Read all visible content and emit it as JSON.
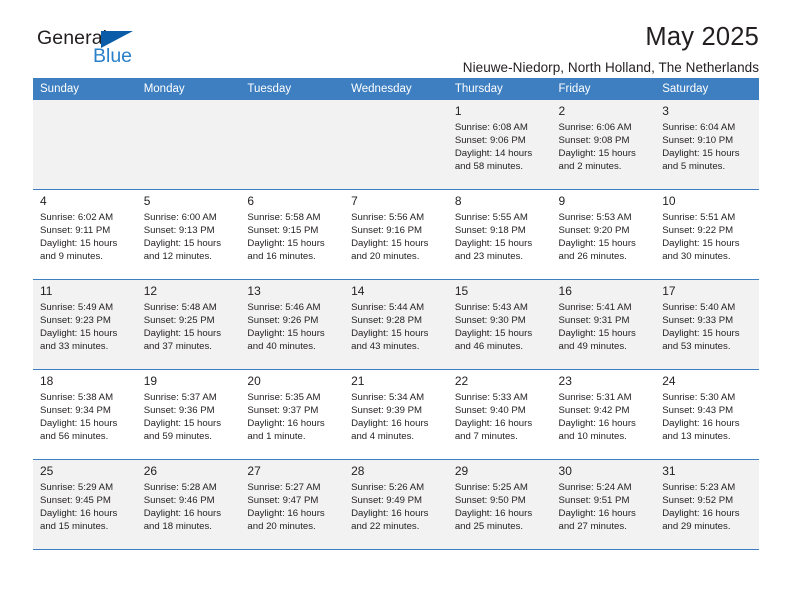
{
  "brand": {
    "name_top": "General",
    "name_bottom": "Blue",
    "triangle_color": "#0a5ca8",
    "blue_text_color": "#2a7fc9"
  },
  "header": {
    "title": "May 2025",
    "subtitle": "Nieuwe-Niedorp, North Holland, The Netherlands",
    "header_bg": "#3d7fc1",
    "shaded_cell_bg": "#f2f2f2"
  },
  "weekdays": [
    "Sunday",
    "Monday",
    "Tuesday",
    "Wednesday",
    "Thursday",
    "Friday",
    "Saturday"
  ],
  "weeks": [
    [
      {
        "day": "",
        "lines": [],
        "shaded": true,
        "empty": true
      },
      {
        "day": "",
        "lines": [],
        "shaded": true,
        "empty": true
      },
      {
        "day": "",
        "lines": [],
        "shaded": true,
        "empty": true
      },
      {
        "day": "",
        "lines": [],
        "shaded": true,
        "empty": true
      },
      {
        "day": "1",
        "lines": [
          "Sunrise: 6:08 AM",
          "Sunset: 9:06 PM",
          "Daylight: 14 hours",
          "and 58 minutes."
        ],
        "shaded": true,
        "empty": false
      },
      {
        "day": "2",
        "lines": [
          "Sunrise: 6:06 AM",
          "Sunset: 9:08 PM",
          "Daylight: 15 hours",
          "and 2 minutes."
        ],
        "shaded": true,
        "empty": false
      },
      {
        "day": "3",
        "lines": [
          "Sunrise: 6:04 AM",
          "Sunset: 9:10 PM",
          "Daylight: 15 hours",
          "and 5 minutes."
        ],
        "shaded": true,
        "empty": false
      }
    ],
    [
      {
        "day": "4",
        "lines": [
          "Sunrise: 6:02 AM",
          "Sunset: 9:11 PM",
          "Daylight: 15 hours",
          "and 9 minutes."
        ],
        "shaded": false,
        "empty": false
      },
      {
        "day": "5",
        "lines": [
          "Sunrise: 6:00 AM",
          "Sunset: 9:13 PM",
          "Daylight: 15 hours",
          "and 12 minutes."
        ],
        "shaded": false,
        "empty": false
      },
      {
        "day": "6",
        "lines": [
          "Sunrise: 5:58 AM",
          "Sunset: 9:15 PM",
          "Daylight: 15 hours",
          "and 16 minutes."
        ],
        "shaded": false,
        "empty": false
      },
      {
        "day": "7",
        "lines": [
          "Sunrise: 5:56 AM",
          "Sunset: 9:16 PM",
          "Daylight: 15 hours",
          "and 20 minutes."
        ],
        "shaded": false,
        "empty": false
      },
      {
        "day": "8",
        "lines": [
          "Sunrise: 5:55 AM",
          "Sunset: 9:18 PM",
          "Daylight: 15 hours",
          "and 23 minutes."
        ],
        "shaded": false,
        "empty": false
      },
      {
        "day": "9",
        "lines": [
          "Sunrise: 5:53 AM",
          "Sunset: 9:20 PM",
          "Daylight: 15 hours",
          "and 26 minutes."
        ],
        "shaded": false,
        "empty": false
      },
      {
        "day": "10",
        "lines": [
          "Sunrise: 5:51 AM",
          "Sunset: 9:22 PM",
          "Daylight: 15 hours",
          "and 30 minutes."
        ],
        "shaded": false,
        "empty": false
      }
    ],
    [
      {
        "day": "11",
        "lines": [
          "Sunrise: 5:49 AM",
          "Sunset: 9:23 PM",
          "Daylight: 15 hours",
          "and 33 minutes."
        ],
        "shaded": true,
        "empty": false
      },
      {
        "day": "12",
        "lines": [
          "Sunrise: 5:48 AM",
          "Sunset: 9:25 PM",
          "Daylight: 15 hours",
          "and 37 minutes."
        ],
        "shaded": true,
        "empty": false
      },
      {
        "day": "13",
        "lines": [
          "Sunrise: 5:46 AM",
          "Sunset: 9:26 PM",
          "Daylight: 15 hours",
          "and 40 minutes."
        ],
        "shaded": true,
        "empty": false
      },
      {
        "day": "14",
        "lines": [
          "Sunrise: 5:44 AM",
          "Sunset: 9:28 PM",
          "Daylight: 15 hours",
          "and 43 minutes."
        ],
        "shaded": true,
        "empty": false
      },
      {
        "day": "15",
        "lines": [
          "Sunrise: 5:43 AM",
          "Sunset: 9:30 PM",
          "Daylight: 15 hours",
          "and 46 minutes."
        ],
        "shaded": true,
        "empty": false
      },
      {
        "day": "16",
        "lines": [
          "Sunrise: 5:41 AM",
          "Sunset: 9:31 PM",
          "Daylight: 15 hours",
          "and 49 minutes."
        ],
        "shaded": true,
        "empty": false
      },
      {
        "day": "17",
        "lines": [
          "Sunrise: 5:40 AM",
          "Sunset: 9:33 PM",
          "Daylight: 15 hours",
          "and 53 minutes."
        ],
        "shaded": true,
        "empty": false
      }
    ],
    [
      {
        "day": "18",
        "lines": [
          "Sunrise: 5:38 AM",
          "Sunset: 9:34 PM",
          "Daylight: 15 hours",
          "and 56 minutes."
        ],
        "shaded": false,
        "empty": false
      },
      {
        "day": "19",
        "lines": [
          "Sunrise: 5:37 AM",
          "Sunset: 9:36 PM",
          "Daylight: 15 hours",
          "and 59 minutes."
        ],
        "shaded": false,
        "empty": false
      },
      {
        "day": "20",
        "lines": [
          "Sunrise: 5:35 AM",
          "Sunset: 9:37 PM",
          "Daylight: 16 hours",
          "and 1 minute."
        ],
        "shaded": false,
        "empty": false
      },
      {
        "day": "21",
        "lines": [
          "Sunrise: 5:34 AM",
          "Sunset: 9:39 PM",
          "Daylight: 16 hours",
          "and 4 minutes."
        ],
        "shaded": false,
        "empty": false
      },
      {
        "day": "22",
        "lines": [
          "Sunrise: 5:33 AM",
          "Sunset: 9:40 PM",
          "Daylight: 16 hours",
          "and 7 minutes."
        ],
        "shaded": false,
        "empty": false
      },
      {
        "day": "23",
        "lines": [
          "Sunrise: 5:31 AM",
          "Sunset: 9:42 PM",
          "Daylight: 16 hours",
          "and 10 minutes."
        ],
        "shaded": false,
        "empty": false
      },
      {
        "day": "24",
        "lines": [
          "Sunrise: 5:30 AM",
          "Sunset: 9:43 PM",
          "Daylight: 16 hours",
          "and 13 minutes."
        ],
        "shaded": false,
        "empty": false
      }
    ],
    [
      {
        "day": "25",
        "lines": [
          "Sunrise: 5:29 AM",
          "Sunset: 9:45 PM",
          "Daylight: 16 hours",
          "and 15 minutes."
        ],
        "shaded": true,
        "empty": false
      },
      {
        "day": "26",
        "lines": [
          "Sunrise: 5:28 AM",
          "Sunset: 9:46 PM",
          "Daylight: 16 hours",
          "and 18 minutes."
        ],
        "shaded": true,
        "empty": false
      },
      {
        "day": "27",
        "lines": [
          "Sunrise: 5:27 AM",
          "Sunset: 9:47 PM",
          "Daylight: 16 hours",
          "and 20 minutes."
        ],
        "shaded": true,
        "empty": false
      },
      {
        "day": "28",
        "lines": [
          "Sunrise: 5:26 AM",
          "Sunset: 9:49 PM",
          "Daylight: 16 hours",
          "and 22 minutes."
        ],
        "shaded": true,
        "empty": false
      },
      {
        "day": "29",
        "lines": [
          "Sunrise: 5:25 AM",
          "Sunset: 9:50 PM",
          "Daylight: 16 hours",
          "and 25 minutes."
        ],
        "shaded": true,
        "empty": false
      },
      {
        "day": "30",
        "lines": [
          "Sunrise: 5:24 AM",
          "Sunset: 9:51 PM",
          "Daylight: 16 hours",
          "and 27 minutes."
        ],
        "shaded": true,
        "empty": false
      },
      {
        "day": "31",
        "lines": [
          "Sunrise: 5:23 AM",
          "Sunset: 9:52 PM",
          "Daylight: 16 hours",
          "and 29 minutes."
        ],
        "shaded": true,
        "empty": false
      }
    ]
  ]
}
